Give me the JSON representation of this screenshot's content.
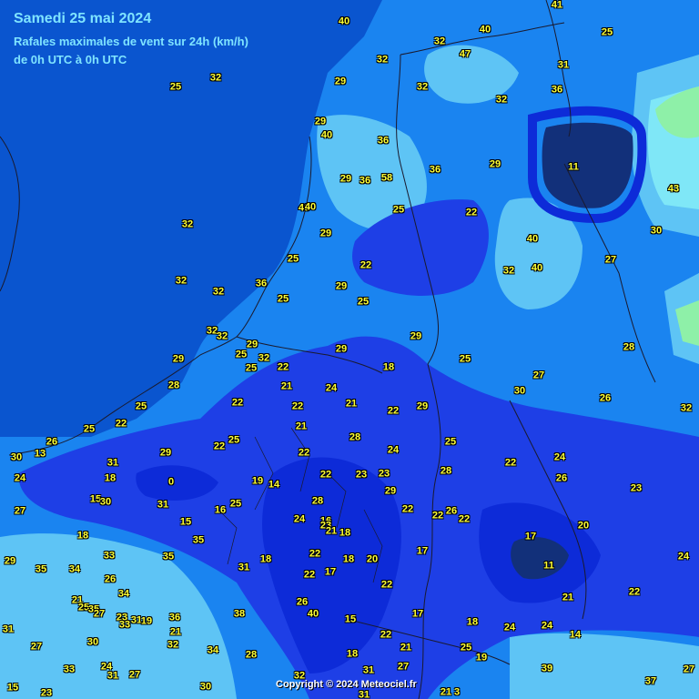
{
  "header": {
    "title": "Samedi 25 mai 2024",
    "subtitle": "Rafales maximales de vent sur 24h (km/h)",
    "period": "de 0h UTC à 0h UTC"
  },
  "footer": {
    "copyright": "Copyright © 2024 Meteociel.fr"
  },
  "colors": {
    "sea": "#0a55cf",
    "band_light": "#1a84f0",
    "band_cyan": "#5ec4f5",
    "band_pale": "#7fe7f7",
    "band_green": "#8ef0a8",
    "band_strong_blue": "#1e3fe6",
    "band_deep": "#0d2bd8",
    "band_navy": "#12307a",
    "label_text": "#ffff33",
    "header_text": "#7fe4ff"
  },
  "wind_values": [
    "40",
    "41",
    "25",
    "40",
    "32",
    "47",
    "32",
    "25",
    "32",
    "29",
    "31",
    "36",
    "32",
    "29",
    "40",
    "36",
    "32",
    "36",
    "58",
    "29",
    "29",
    "11",
    "43",
    "36",
    "25",
    "22",
    "32",
    "40",
    "29",
    "40",
    "30",
    "32",
    "25",
    "22",
    "40",
    "32",
    "27",
    "36",
    "32",
    "40",
    "29",
    "25",
    "25",
    "29",
    "32",
    "29",
    "28",
    "29",
    "25",
    "32",
    "32",
    "18",
    "29",
    "25",
    "22",
    "25",
    "27",
    "28",
    "22",
    "21",
    "24",
    "21",
    "30",
    "26",
    "32",
    "29",
    "25",
    "22",
    "22",
    "22",
    "21",
    "25",
    "28",
    "25",
    "22",
    "25",
    "26",
    "24",
    "22",
    "29",
    "30",
    "13",
    "22",
    "24",
    "31",
    "18",
    "0",
    "19",
    "22",
    "23",
    "23",
    "28",
    "26",
    "23",
    "24",
    "14",
    "15",
    "30",
    "31",
    "16",
    "25",
    "28",
    "29",
    "22",
    "22",
    "26",
    "22",
    "27",
    "15",
    "16",
    "20",
    "23",
    "35",
    "18",
    "24",
    "17",
    "18",
    "21",
    "17",
    "11",
    "29",
    "33",
    "35",
    "31",
    "18",
    "18",
    "20",
    "24",
    "22",
    "35",
    "22",
    "17",
    "34",
    "22",
    "26",
    "26",
    "21",
    "34",
    "22",
    "21",
    "25",
    "35",
    "27",
    "23",
    "33",
    "31",
    "19",
    "36",
    "38",
    "15",
    "17",
    "18",
    "24",
    "24",
    "14",
    "31",
    "21",
    "32",
    "27",
    "40",
    "30",
    "34",
    "28",
    "22",
    "21",
    "19",
    "25",
    "33",
    "24",
    "31",
    "32",
    "27",
    "30",
    "18",
    "31",
    "27",
    "37",
    "27",
    "39",
    "15",
    "21",
    "23",
    "3",
    "31"
  ]
}
